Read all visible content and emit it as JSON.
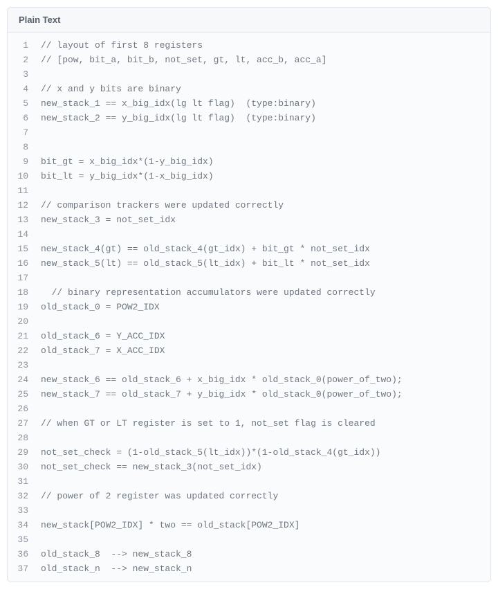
{
  "header": {
    "label": "Plain Text"
  },
  "code": {
    "lines": [
      "// layout of first 8 registers",
      "// [pow, bit_a, bit_b, not_set, gt, lt, acc_b, acc_a]",
      "",
      "// x and y bits are binary",
      "new_stack_1 == x_big_idx(lg lt flag)  (type:binary)",
      "new_stack_2 == y_big_idx(lg lt flag)  (type:binary)",
      "",
      "",
      "bit_gt = x_big_idx*(1-y_big_idx)",
      "bit_lt = y_big_idx*(1-x_big_idx)",
      "",
      "// comparison trackers were updated correctly",
      "new_stack_3 = not_set_idx",
      "",
      "new_stack_4(gt) == old_stack_4(gt_idx) + bit_gt * not_set_idx",
      "new_stack_5(lt) == old_stack_5(lt_idx) + bit_lt * not_set_idx",
      "",
      "  // binary representation accumulators were updated correctly",
      "old_stack_0 = POW2_IDX",
      "",
      "old_stack_6 = Y_ACC_IDX",
      "old_stack_7 = X_ACC_IDX",
      "",
      "new_stack_6 == old_stack_6 + x_big_idx * old_stack_0(power_of_two);",
      "new_stack_7 == old_stack_7 + y_big_idx * old_stack_0(power_of_two);",
      "",
      "// when GT or LT register is set to 1, not_set flag is cleared",
      "",
      "not_set_check = (1-old_stack_5(lt_idx))*(1-old_stack_4(gt_idx))",
      "not_set_check == new_stack_3(not_set_idx)",
      "",
      "// power of 2 register was updated correctly",
      "",
      "new_stack[POW2_IDX] * two == old_stack[POW2_IDX]",
      "",
      "old_stack_8  --> new_stack_8",
      "old_stack_n  --> new_stack_n"
    ]
  }
}
